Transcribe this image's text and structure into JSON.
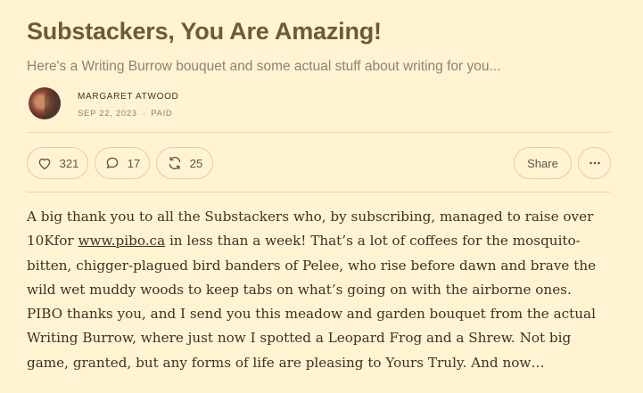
{
  "post": {
    "title": "Substackers, You Are Amazing!",
    "subtitle": "Here's a Writing Burrow bouquet and some actual stuff about writing for you...",
    "author": "MARGARET ATWOOD",
    "date": "SEP 22, 2023",
    "separator": "∙",
    "access": "PAID"
  },
  "actions": {
    "likes": "321",
    "comments": "17",
    "restacks": "25",
    "share_label": "Share"
  },
  "icons": {
    "like": "heart-icon",
    "comment": "comment-bubble-icon",
    "restack": "restack-arrows-icon",
    "more": "ellipsis-icon"
  },
  "body": {
    "text_before_link": "A big thank you to all the Substackers who, by subscribing, managed to raise over 10Kfor ",
    "link_text": "www.pibo.ca",
    "text_after_link": " in less than a week! That’s a lot of coffees for the mosquito-bitten, chigger-plagued bird banders of Pelee, who rise before dawn and brave the wild wet muddy woods to keep tabs on what’s going on with the airborne ones. PIBO thanks you, and I send you this meadow and garden bouquet from the actual Writing Burrow, where just now I spotted a Leopard Frog and a Shrew. Not big game, granted, but any forms of life are pleasing to Yours Truly. And now…"
  }
}
